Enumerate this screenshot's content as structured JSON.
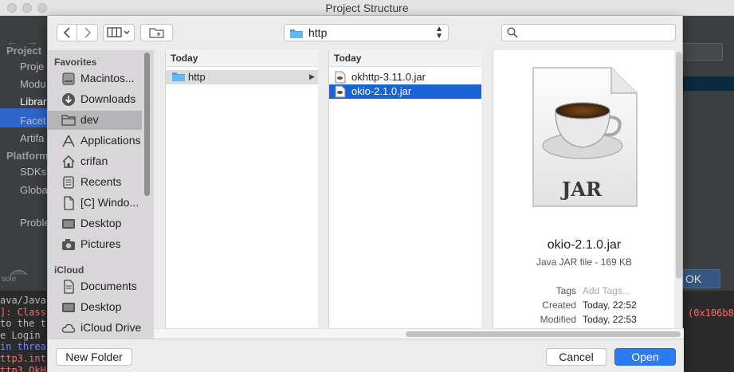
{
  "window": {
    "title": "Project Structure"
  },
  "ide": {
    "sidebar_items": [
      {
        "label": "Project",
        "kind": "header"
      },
      {
        "label": "Proje",
        "kind": "item"
      },
      {
        "label": "Modu",
        "kind": "item"
      },
      {
        "label": "Librar",
        "kind": "item",
        "selected": true
      },
      {
        "label": "Facet",
        "kind": "item"
      },
      {
        "label": "Artifa",
        "kind": "item"
      },
      {
        "label": "Platform",
        "kind": "header"
      },
      {
        "label": "SDKs",
        "kind": "item"
      },
      {
        "label": "Globa",
        "kind": "item"
      },
      {
        "label": "Proble",
        "kind": "item"
      }
    ],
    "help_label": "?",
    "ok_label": "OK",
    "console_tab": "sole",
    "console_lines": [
      {
        "text": "ava/Java",
        "color": "#bbbbbb"
      },
      {
        "text": "]: Class",
        "color": "#ff6b68"
      },
      {
        "text": "to the t",
        "color": "#bbbbbb"
      },
      {
        "text": "e Login ",
        "color": "#bbbbbb"
      },
      {
        "text": " in threa",
        "color": "#6e8be8"
      },
      {
        "text": "ttp3.int",
        "color": "#ff6b68"
      },
      {
        "text": "ttp3.OkH",
        "color": "#ff6b68"
      }
    ],
    "console_right": "(0x106b84"
  },
  "dialog": {
    "toolbar": {
      "back_icon": "chevron-left-icon",
      "forward_icon": "chevron-right-icon",
      "view_icon": "column-view-icon",
      "new_folder_icon": "new-folder-icon",
      "path_value": "http",
      "search_placeholder": ""
    },
    "sidebar": {
      "favorites_header": "Favorites",
      "favorites": [
        {
          "label": "Macintos...",
          "icon": "hard-drive-icon"
        },
        {
          "label": "Downloads",
          "icon": "downloads-icon"
        },
        {
          "label": "dev",
          "icon": "folder-icon",
          "selected": true
        },
        {
          "label": "Applications",
          "icon": "applications-icon"
        },
        {
          "label": "crifan",
          "icon": "home-icon"
        },
        {
          "label": "Recents",
          "icon": "recents-icon"
        },
        {
          "label": "[C] Windo...",
          "icon": "document-icon"
        },
        {
          "label": "Desktop",
          "icon": "desktop-icon"
        },
        {
          "label": "Pictures",
          "icon": "camera-icon"
        }
      ],
      "icloud_header": "iCloud",
      "icloud": [
        {
          "label": "Documents",
          "icon": "documents-icon"
        },
        {
          "label": "Desktop",
          "icon": "desktop-icon"
        },
        {
          "label": "iCloud Drive",
          "icon": "cloud-icon"
        }
      ]
    },
    "column1": {
      "header": "Today",
      "items": [
        {
          "label": "http",
          "icon": "folder-icon",
          "has_children": true
        }
      ]
    },
    "column2": {
      "header": "Today",
      "items": [
        {
          "label": "okhttp-3.11.0.jar",
          "icon": "jar-file-icon"
        },
        {
          "label": "okio-2.1.0.jar",
          "icon": "jar-file-icon",
          "selected": true
        }
      ]
    },
    "preview": {
      "icon_label": "JAR",
      "name": "okio-2.1.0.jar",
      "kind": "Java JAR file - 169 KB",
      "tags_label": "Tags",
      "tags_placeholder": "Add Tags...",
      "created_label": "Created",
      "created_value": "Today, 22:52",
      "modified_label": "Modified",
      "modified_value": "Today, 22:53"
    },
    "buttons": {
      "new_folder": "New Folder",
      "cancel": "Cancel",
      "open": "Open"
    },
    "colors": {
      "accent": "#1863d6",
      "primary_button": "#2a7cf0"
    }
  }
}
